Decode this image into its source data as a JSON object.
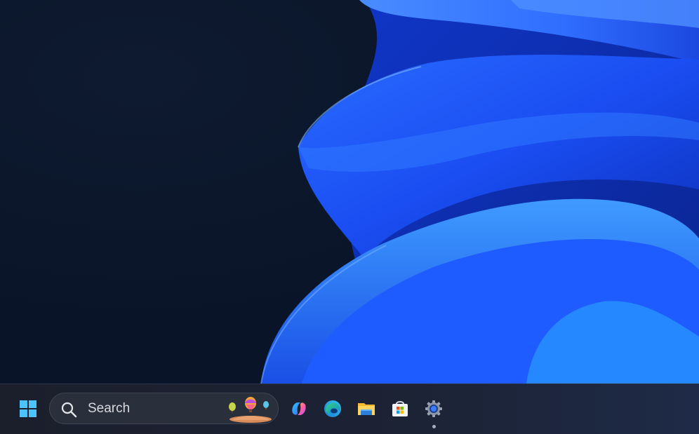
{
  "taskbar": {
    "start": "start-button",
    "search": {
      "placeholder": "Search"
    },
    "pinned": [
      {
        "name": "copilot",
        "icon": "copilot-icon"
      },
      {
        "name": "edge",
        "icon": "edge-icon"
      },
      {
        "name": "file-explorer",
        "icon": "folder-icon"
      },
      {
        "name": "microsoft-store",
        "icon": "store-icon"
      },
      {
        "name": "settings",
        "icon": "gear-icon",
        "running": true
      }
    ]
  },
  "colors": {
    "accent": "#1a73ff",
    "wallpaper_dark": "#0a1428",
    "taskbar": "#1c2335"
  }
}
